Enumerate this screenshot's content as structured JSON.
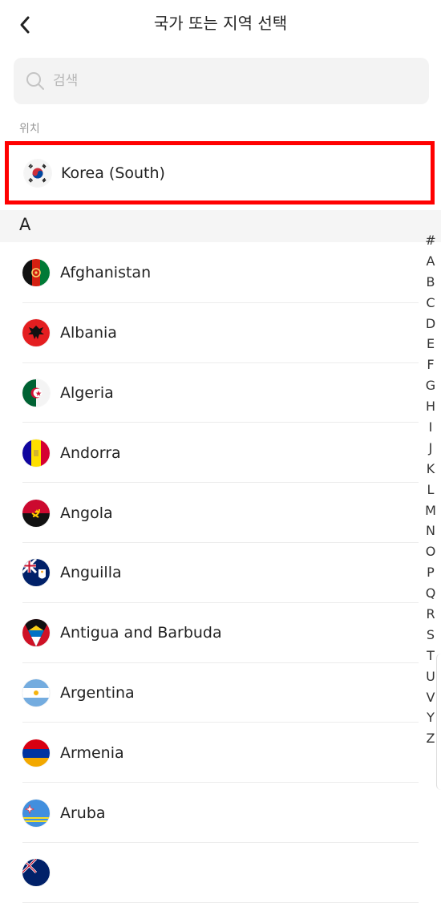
{
  "header": {
    "title": "국가 또는 지역 선택",
    "back_icon": "chevron-left-icon"
  },
  "search": {
    "placeholder": "검색",
    "value": "",
    "icon": "search-icon"
  },
  "location": {
    "label": "위치",
    "country": "Korea (South)",
    "flag": "kr-flag-icon"
  },
  "section_letter": "A",
  "countries": [
    {
      "name": "Afghanistan",
      "flag": "af-flag-icon"
    },
    {
      "name": "Albania",
      "flag": "al-flag-icon"
    },
    {
      "name": "Algeria",
      "flag": "dz-flag-icon"
    },
    {
      "name": "Andorra",
      "flag": "ad-flag-icon"
    },
    {
      "name": "Angola",
      "flag": "ao-flag-icon"
    },
    {
      "name": "Anguilla",
      "flag": "ai-flag-icon"
    },
    {
      "name": "Antigua and Barbuda",
      "flag": "ag-flag-icon"
    },
    {
      "name": "Argentina",
      "flag": "ar-flag-icon"
    },
    {
      "name": "Armenia",
      "flag": "am-flag-icon"
    },
    {
      "name": "Aruba",
      "flag": "aw-flag-icon"
    },
    {
      "name": "",
      "flag": "next-flag-icon"
    }
  ],
  "index_letters": [
    "#",
    "A",
    "B",
    "C",
    "D",
    "E",
    "F",
    "G",
    "H",
    "I",
    "J",
    "K",
    "L",
    "M",
    "N",
    "O",
    "P",
    "Q",
    "R",
    "S",
    "T",
    "U",
    "V",
    "Y",
    "Z"
  ],
  "colors": {
    "highlight_border": "#ff0000",
    "search_bg": "#f3f3f3",
    "section_bg": "#f5f5f5"
  }
}
